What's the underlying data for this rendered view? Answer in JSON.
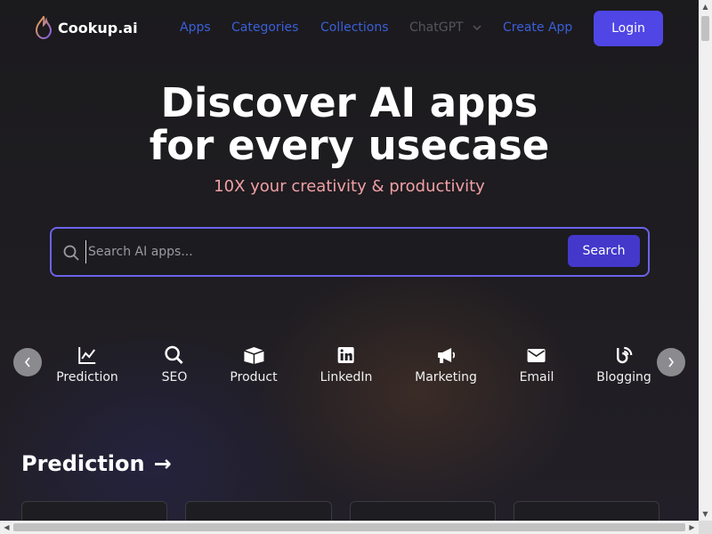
{
  "header": {
    "logo_text": "Cookup.ai",
    "nav": [
      {
        "label": "Apps"
      },
      {
        "label": "Categories"
      },
      {
        "label": "Collections"
      },
      {
        "label": "ChatGPT"
      },
      {
        "label": "Create App"
      }
    ],
    "login_label": "Login"
  },
  "hero": {
    "title_line1": "Discover AI apps",
    "title_line2": "for every usecase",
    "subtitle": "10X your creativity & productivity"
  },
  "search": {
    "placeholder": "Search AI apps...",
    "value": "",
    "button_label": "Search"
  },
  "categories": [
    {
      "label": "Prediction",
      "icon": "chart-line-icon"
    },
    {
      "label": "SEO",
      "icon": "magnifier-icon"
    },
    {
      "label": "Product",
      "icon": "box-icon"
    },
    {
      "label": "LinkedIn",
      "icon": "linkedin-icon"
    },
    {
      "label": "Marketing",
      "icon": "megaphone-icon"
    },
    {
      "label": "Email",
      "icon": "envelope-icon"
    },
    {
      "label": "Blogging",
      "icon": "blog-icon"
    }
  ],
  "section": {
    "title": "Prediction",
    "arrow": "→"
  },
  "colors": {
    "accent": "#4f46e5",
    "nav_link": "#3b5fd9",
    "subtitle": "#f2a0a6",
    "background": "#1b1a1d"
  }
}
